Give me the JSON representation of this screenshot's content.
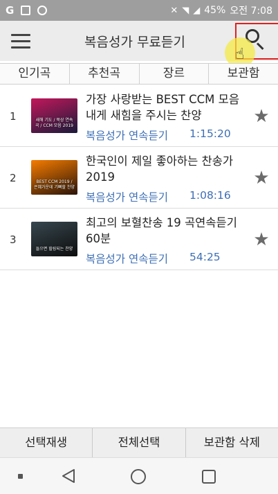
{
  "status_bar": {
    "left_icons": [
      "google-g-icon",
      "image-icon",
      "location-icon"
    ],
    "g_label": "G",
    "right_icons": [
      "mute-icon",
      "wifi-icon",
      "signal-icon"
    ],
    "battery": "45%",
    "time": "오전 7:08"
  },
  "app_bar": {
    "title": "복음성가 무료듣기",
    "menu_icon": "hamburger-menu-icon",
    "search_icon": "search-icon"
  },
  "tabs": [
    {
      "label": "인기곡"
    },
    {
      "label": "추천곡"
    },
    {
      "label": "장르"
    },
    {
      "label": "보관함"
    }
  ],
  "list": {
    "items": [
      {
        "num": "1",
        "title": "가장 사랑받는 BEST CCM 모음 내게 새힘을 주시는 찬양",
        "artist": "복음성가 연속듣기",
        "duration": "1:15:20",
        "thumb_text": "새해 기도 / 묵상 연속곡 / CCM 모음 2019",
        "thumb_colors": [
          "#c2185b",
          "#1a1a3a"
        ]
      },
      {
        "num": "2",
        "title": "한국인이 제일 좋아하는 찬송가 2019",
        "artist": "복음성가 연속듣기",
        "duration": "1:08:16",
        "thumb_text": "BEST CCM 2019 / 은혜가운데 기뻐할 찬양",
        "thumb_colors": [
          "#f57c00",
          "#2a1408"
        ]
      },
      {
        "num": "3",
        "title": "최고의 보혈찬송 19 곡연속듣기 60분",
        "artist": "복음성가 연속듣기",
        "duration": "54:25",
        "thumb_text": "들으면 힐링되는 찬양",
        "thumb_colors": [
          "#37474f",
          "#0d0d0d"
        ]
      }
    ]
  },
  "actions": {
    "play_selected": "선택재생",
    "select_all": "전체선택",
    "delete_library": "보관함 삭제"
  },
  "nav": {
    "icons": [
      "nav-dot-icon",
      "back-triangle-icon",
      "home-circle-icon",
      "recent-apps-square-icon"
    ]
  },
  "colors": {
    "accent_link": "#3d6fb5",
    "highlight_box": "#e02020",
    "status_bar_bg": "#9e9e9e"
  }
}
